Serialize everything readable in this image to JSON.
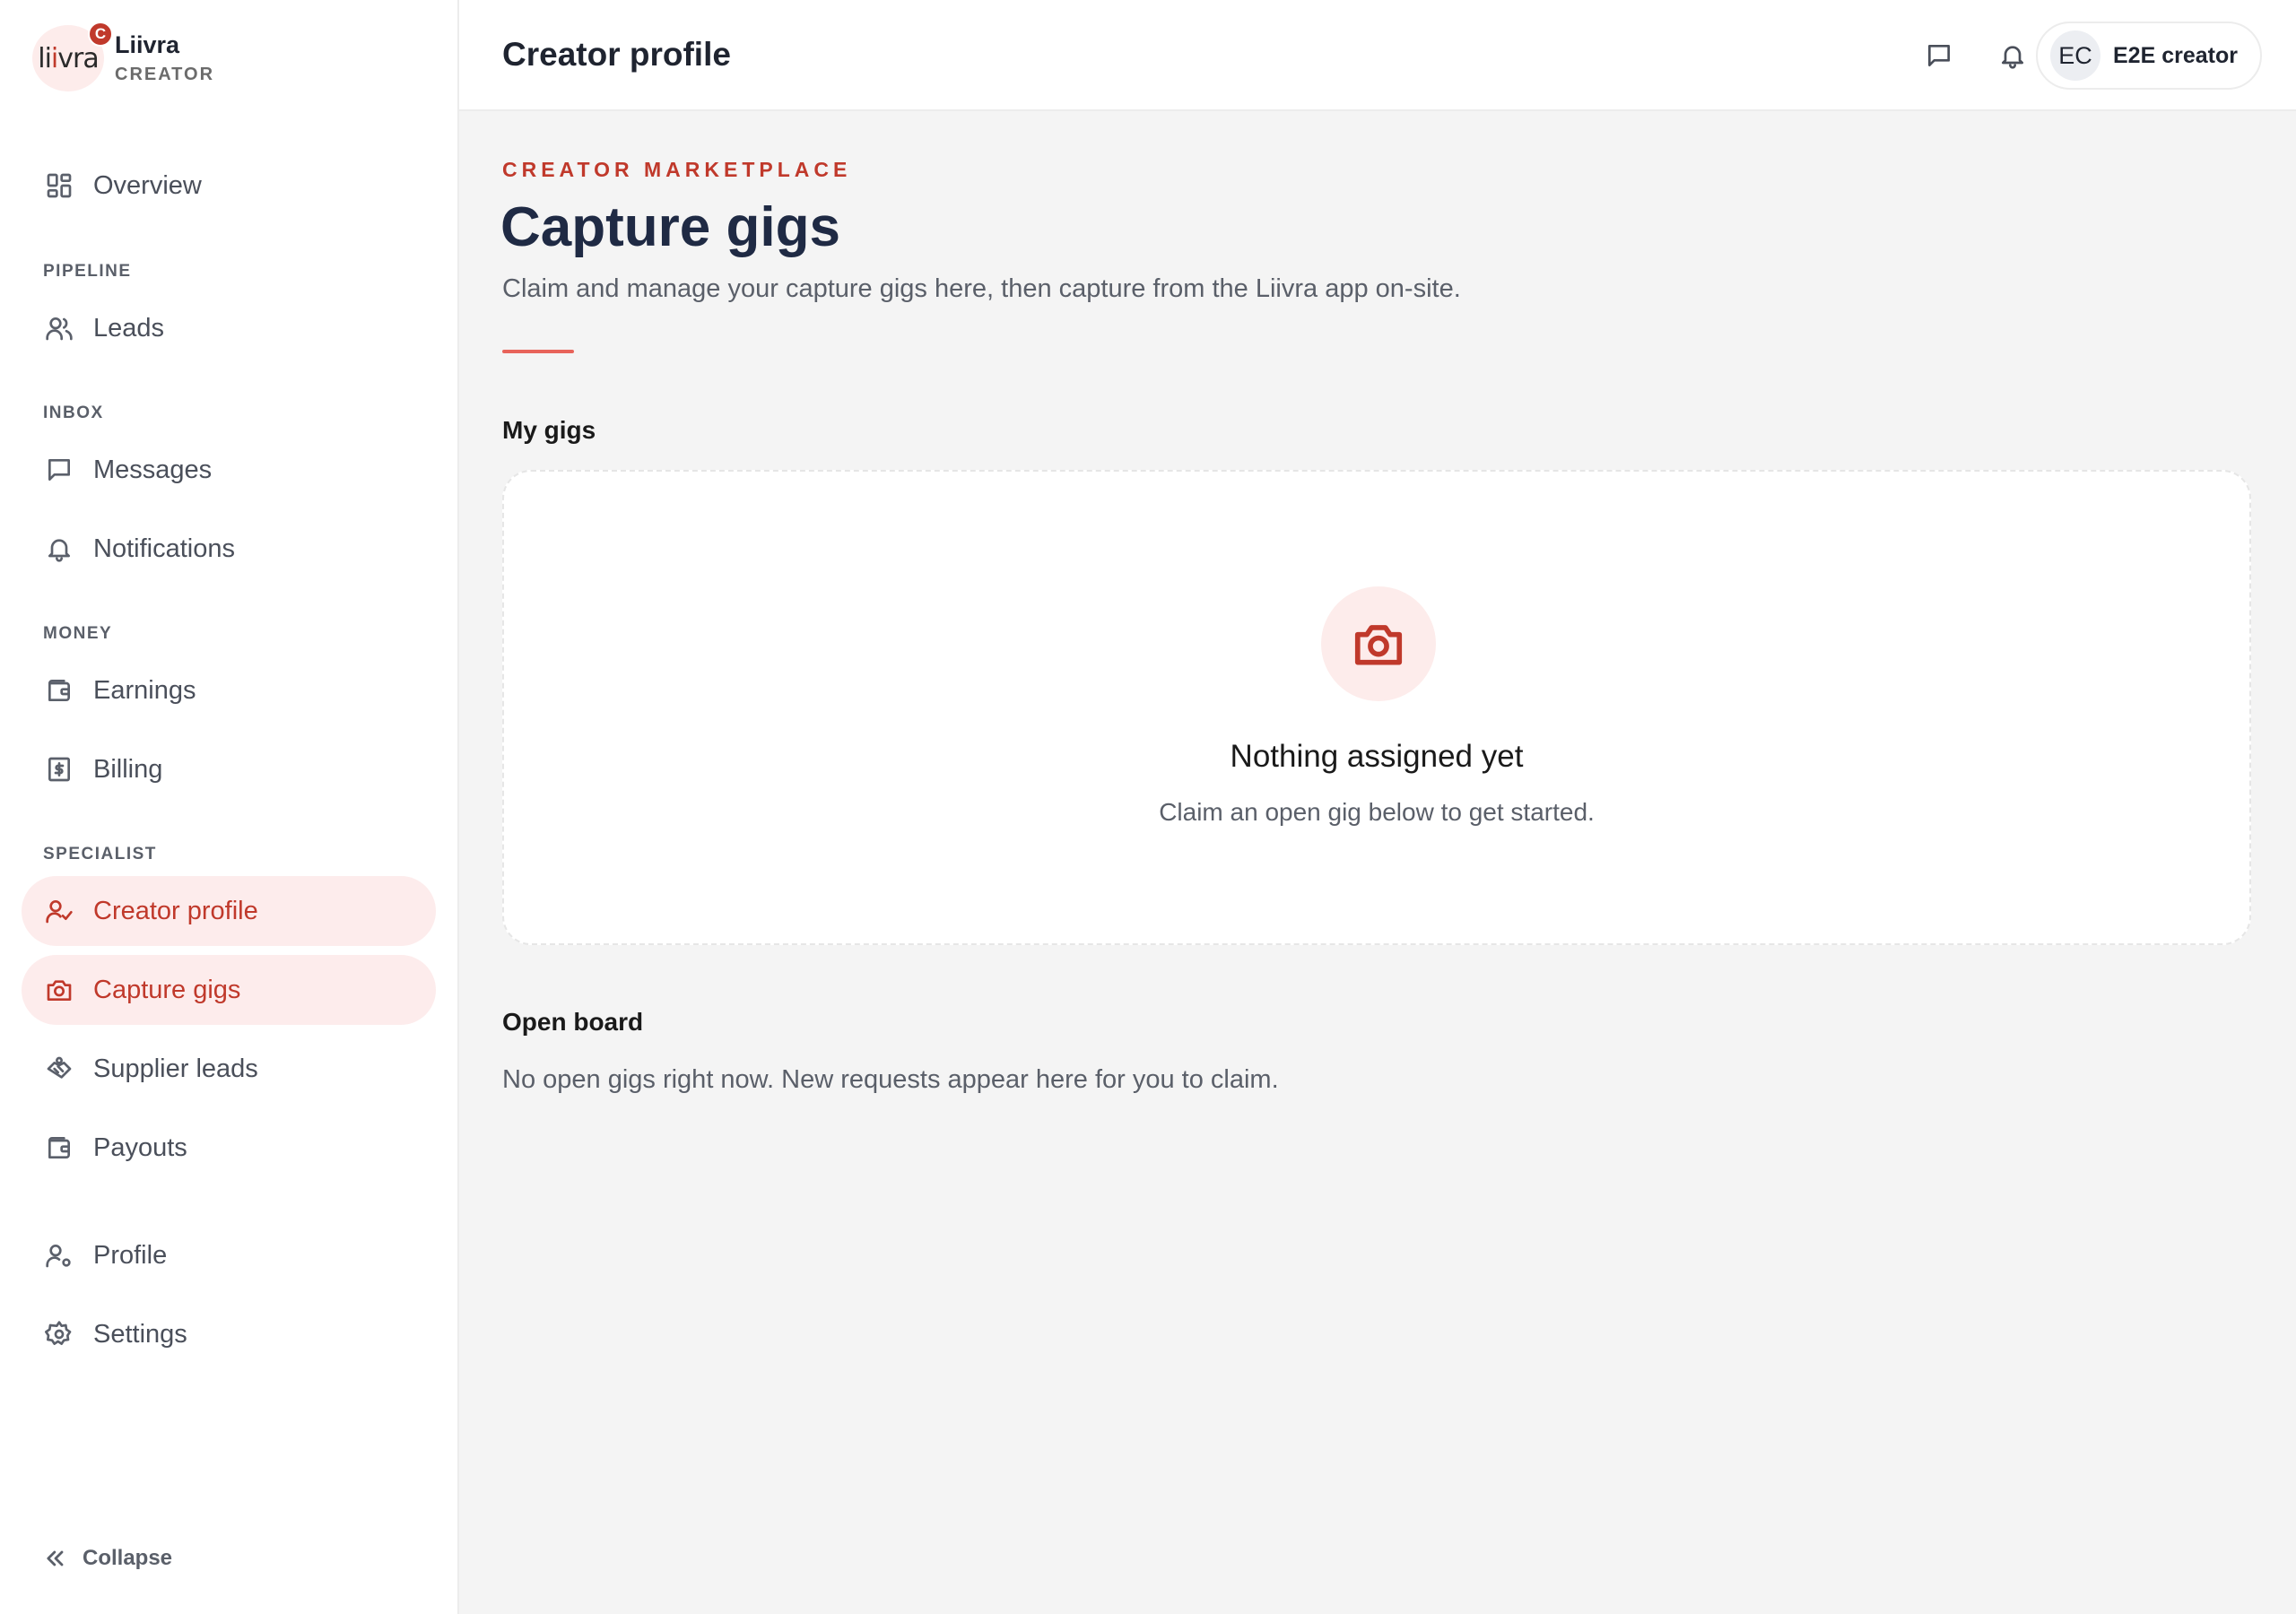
{
  "brand": {
    "logo_text_pre": "li",
    "logo_text_accent": "i",
    "logo_text_post": "vra",
    "badge": "C",
    "name": "Liivra",
    "role": "CREATOR"
  },
  "sidebar": {
    "overview": {
      "label": "Overview",
      "icon": "dashboard-icon"
    },
    "sections": {
      "pipeline": "PIPELINE",
      "inbox": "INBOX",
      "money": "MONEY",
      "specialist": "SPECIALIST"
    },
    "pipeline_items": [
      {
        "label": "Leads",
        "icon": "users-icon"
      }
    ],
    "inbox_items": [
      {
        "label": "Messages",
        "icon": "message-icon"
      },
      {
        "label": "Notifications",
        "icon": "bell-icon"
      }
    ],
    "money_items": [
      {
        "label": "Earnings",
        "icon": "wallet-icon"
      },
      {
        "label": "Billing",
        "icon": "receipt-icon"
      }
    ],
    "specialist_items": [
      {
        "label": "Creator profile",
        "icon": "user-check-icon",
        "active": true
      },
      {
        "label": "Capture gigs",
        "icon": "camera-icon",
        "active": true
      },
      {
        "label": "Supplier leads",
        "icon": "handshake-icon",
        "active": false
      },
      {
        "label": "Payouts",
        "icon": "wallet-icon",
        "active": false
      }
    ],
    "footer_items": [
      {
        "label": "Profile",
        "icon": "user-settings-icon"
      },
      {
        "label": "Settings",
        "icon": "gear-icon"
      }
    ],
    "collapse_label": "Collapse"
  },
  "topbar": {
    "title": "Creator profile",
    "user_initials": "EC",
    "user_name": "E2E creator"
  },
  "main": {
    "eyebrow": "CREATOR MARKETPLACE",
    "title": "Capture gigs",
    "subtitle": "Claim and manage your capture gigs here, then capture from the Liivra app on-site.",
    "my_gigs": {
      "heading": "My gigs",
      "empty_title": "Nothing assigned yet",
      "empty_desc": "Claim an open gig below to get started."
    },
    "open_board": {
      "heading": "Open board",
      "empty_text": "No open gigs right now. New requests appear here for you to claim."
    }
  },
  "colors": {
    "accent": "#c0392b",
    "accent_soft": "#fdecec",
    "rule": "#e8635a",
    "background": "#f4f4f4"
  }
}
